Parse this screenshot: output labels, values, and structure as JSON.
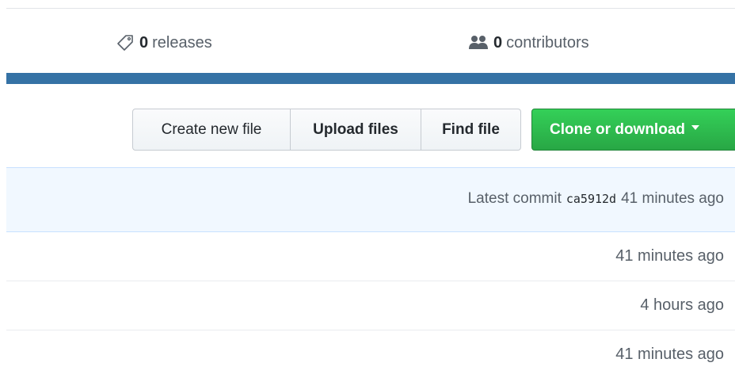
{
  "stats": {
    "releases": {
      "count": "0",
      "label": "releases",
      "icon": "tag-icon"
    },
    "contributors": {
      "count": "0",
      "label": "contributors",
      "icon": "people-icon"
    }
  },
  "language_bar": {
    "color": "#3572a5"
  },
  "file_navigation": {
    "create_new_file": "Create new file",
    "upload_files": "Upload files",
    "find_file": "Find file",
    "clone_or_download": "Clone or download"
  },
  "commit_tease": {
    "prefix": "Latest commit",
    "sha": "ca5912d",
    "age": "41 minutes ago"
  },
  "files": [
    {
      "age": "41 minutes ago"
    },
    {
      "age": "4 hours ago"
    },
    {
      "age": "41 minutes ago"
    }
  ],
  "colors": {
    "green_button": "#28a745",
    "commit_bg": "#f1f8ff",
    "text_muted": "#586069"
  }
}
